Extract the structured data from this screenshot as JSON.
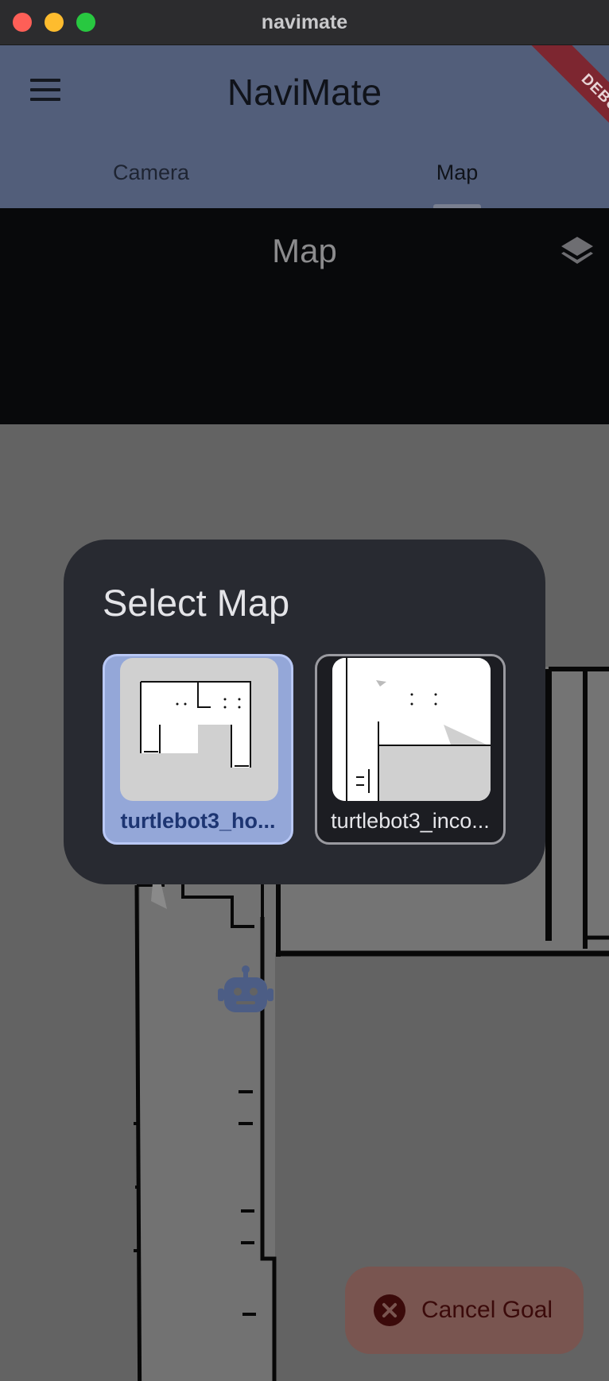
{
  "window": {
    "title": "navimate"
  },
  "appbar": {
    "title": "NaviMate",
    "tabs": [
      {
        "label": "Camera",
        "selected": false
      },
      {
        "label": "Map",
        "selected": true
      }
    ],
    "debug_banner": "DEBUG"
  },
  "map_view": {
    "header_title": "Map",
    "layers_icon": "layers-icon",
    "robot_icon": "robot-icon"
  },
  "dialog": {
    "title": "Select Map",
    "maps": [
      {
        "label": "turtlebot3_ho...",
        "selected": true
      },
      {
        "label": "turtlebot3_inco...",
        "selected": false
      }
    ]
  },
  "cancel_button": {
    "label": "Cancel Goal",
    "icon": "cancel-circle-icon"
  },
  "colors": {
    "appbar": "#525e7a",
    "dialog": "#282a31",
    "selected_card": "#94a7d8",
    "cancel_button": "#795550"
  }
}
